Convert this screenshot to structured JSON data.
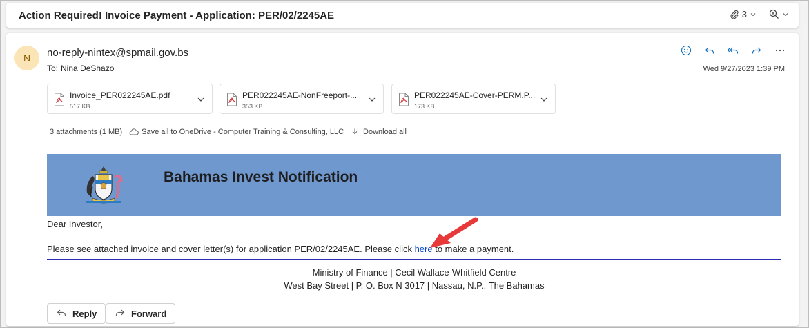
{
  "subject": "Action Required! Invoice Payment - Application: PER/02/2245AE",
  "subject_tools": {
    "attachment_count": "3"
  },
  "sender": {
    "avatar_initial": "N",
    "email": "no-reply-nintex@spmail.gov.bs",
    "to_label": "To:",
    "to_name": "Nina DeShazo",
    "datetime": "Wed 9/27/2023 1:39 PM"
  },
  "attachments": [
    {
      "name": "Invoice_PER022245AE.pdf",
      "size": "517 KB"
    },
    {
      "name": "PER022245AE-NonFreeport-...",
      "size": "353 KB"
    },
    {
      "name": "PER022245AE-Cover-PERM.P...",
      "size": "173 KB"
    }
  ],
  "attachment_summary": {
    "count": "3 attachments (1 MB)",
    "save_all": "Save all to OneDrive - Computer Training & Consulting, LLC",
    "download_all": "Download all"
  },
  "banner": {
    "title": "Bahamas Invest Notification",
    "color": "#6f98cf"
  },
  "body": {
    "greeting": "Dear Investor,",
    "text_before": "Please see attached invoice and cover letter(s) for application PER/02/2245AE. Please click ",
    "link_text": "here",
    "text_after": " to make a payment.",
    "footer_line1": "Ministry of Finance | Cecil Wallace-Whitfield Centre",
    "footer_line2": "West Bay Street | P. O. Box N 3017 | Nassau, N.P., The Bahamas"
  },
  "buttons": {
    "reply": "Reply",
    "forward": "Forward"
  },
  "colors": {
    "link": "#0a47c5",
    "rule": "#2b2bb5",
    "action_icons": "#0f6cbd",
    "annotation_arrow": "#e8393a"
  },
  "icons": {
    "subject_tools": [
      "paperclip-icon",
      "chevron-down-icon",
      "zoom-icon",
      "chevron-down-icon"
    ],
    "actions": [
      "emoji-icon",
      "reply-icon",
      "reply-all-icon",
      "forward-icon",
      "more-icon"
    ],
    "attachment": "pdf-icon",
    "summary": [
      "cloud-icon",
      "download-icon"
    ]
  }
}
